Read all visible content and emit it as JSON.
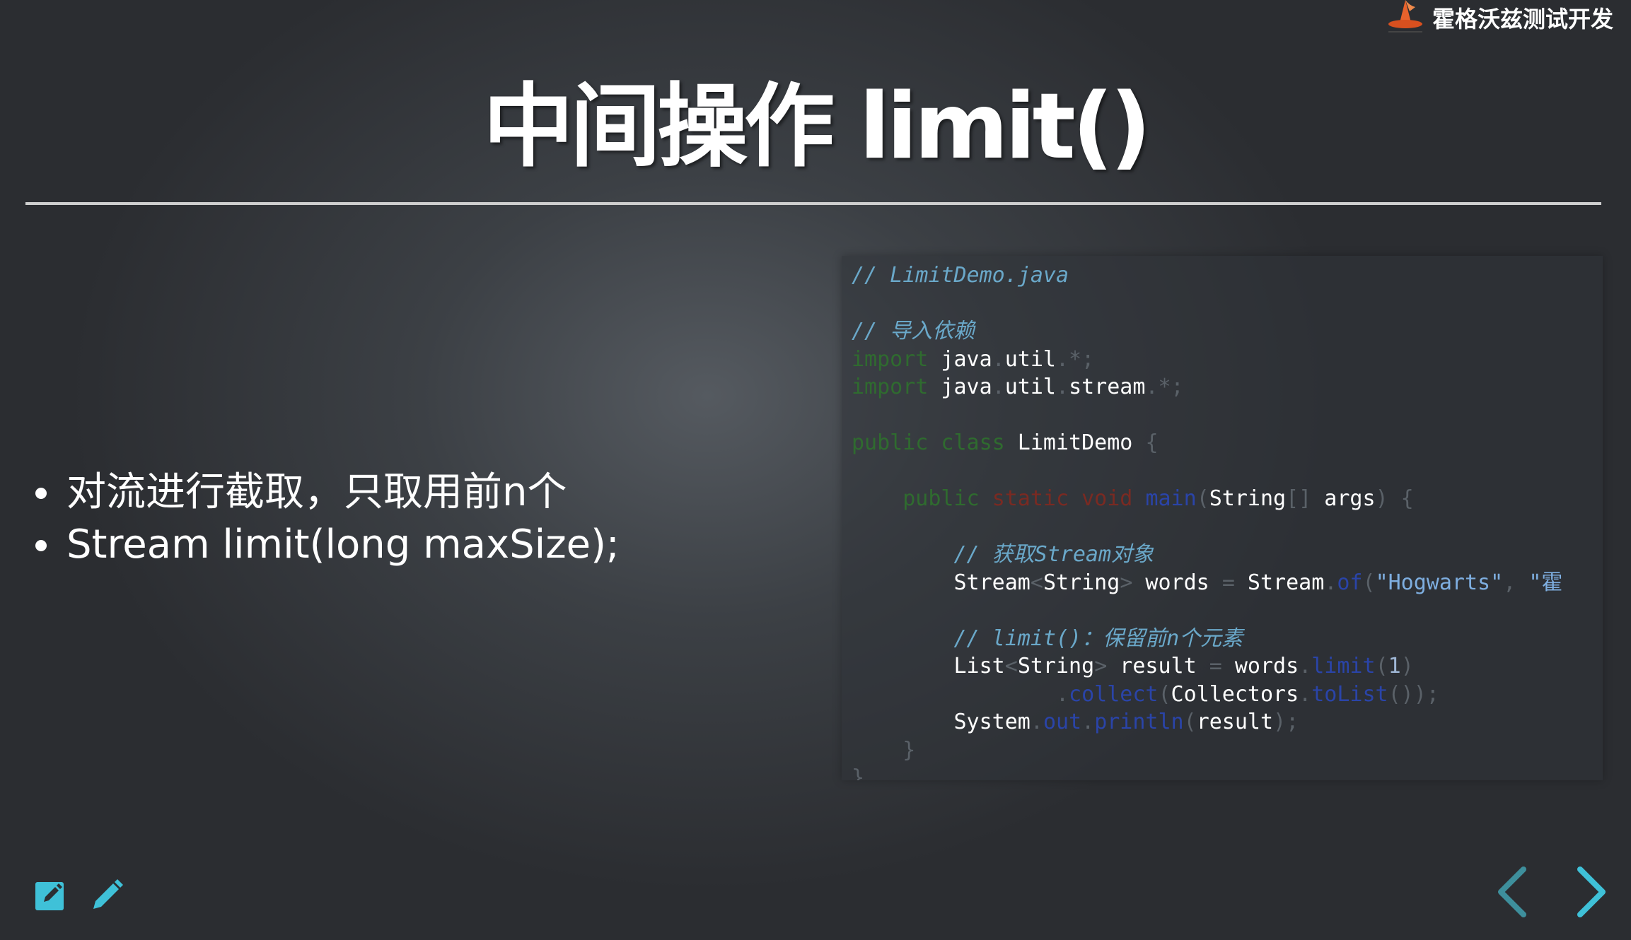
{
  "logo": {
    "text": "霍格沃兹测试开发",
    "icon": "wizard-hat-icon"
  },
  "slide": {
    "title": "中间操作 limit()",
    "bullets": [
      "对流进行截取，只取用前n个",
      "Stream limit(long maxSize);"
    ]
  },
  "code": {
    "file_comment": "// LimitDemo.java",
    "import_comment": "// 导入依赖",
    "lines": [
      "import java.util.*;",
      "import java.util.stream.*;",
      "public class LimitDemo {",
      "public static void main(String[] args) {",
      "// 获取Stream对象",
      "Stream<String> words = Stream.of(\"Hogwarts\", \"霍",
      "// limit()：保留前n个元素",
      "List<String> result = words.limit(1)",
      ".collect(Collectors.toList());",
      "System.out.println(result);",
      "}",
      "}"
    ]
  },
  "controls": {
    "edit_icon": "edit-note-icon",
    "pencil_icon": "pencil-icon",
    "prev_icon": "chevron-left-icon",
    "next_icon": "chevron-right-icon"
  },
  "colors": {
    "accent": "#3fc1d8",
    "nav_prev": "#3e8f9c",
    "background": "#3c4045"
  }
}
